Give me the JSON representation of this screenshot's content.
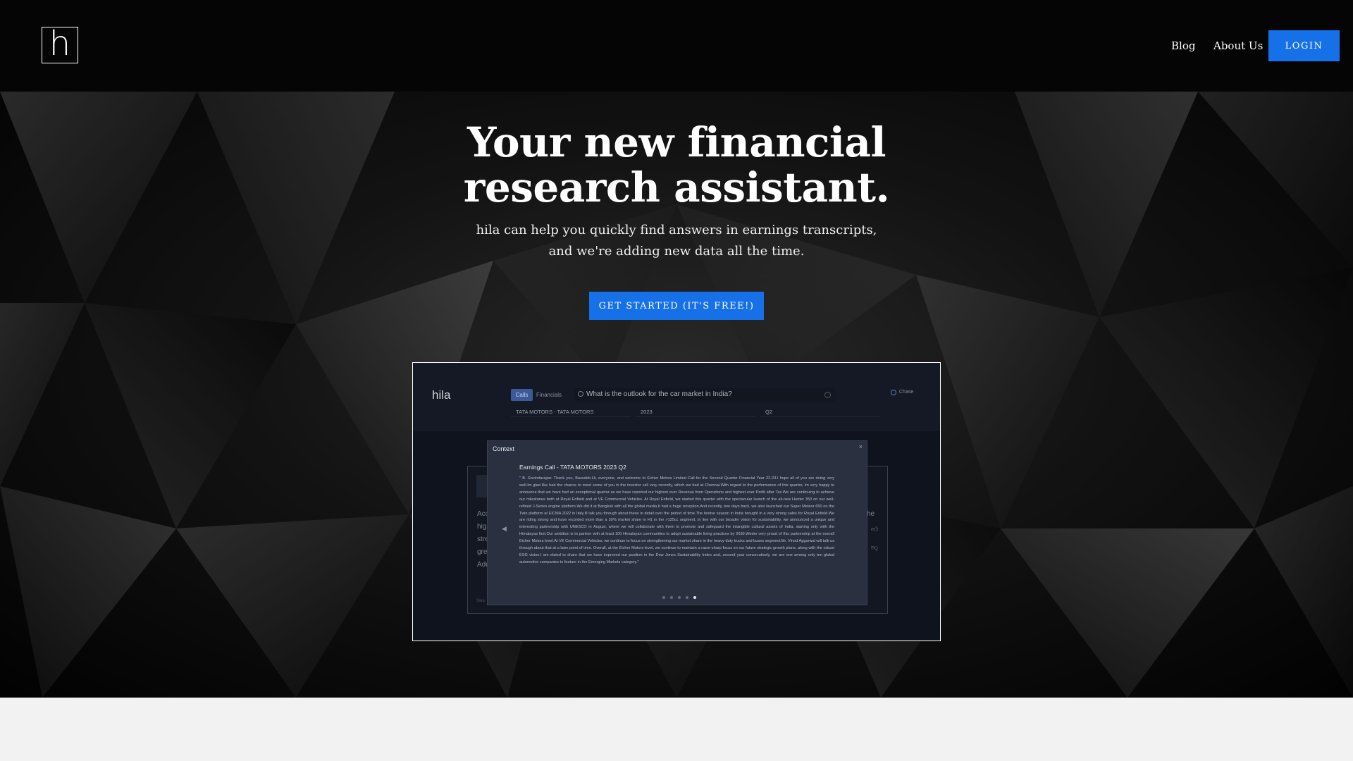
{
  "header": {
    "logo_letter": "h",
    "nav": {
      "blog": "Blog",
      "about": "About Us"
    },
    "login_label": "LOGIN"
  },
  "hero": {
    "headline_line1": "Your new financial",
    "headline_line2": "research assistant.",
    "subtitle_line1": "hila can help you quickly find answers in earnings transcripts,",
    "subtitle_line2": "and we're adding new data all the time.",
    "cta_label": "GET STARTED (IT'S FREE!)"
  },
  "preview": {
    "app_name": "hila",
    "tabs": [
      "Calls",
      "Financials"
    ],
    "search_query": "What is the outlook for the car market in India?",
    "user_label": "Chase",
    "filters": [
      "TATA MOTORS - TATA MOTORS",
      "2023",
      "Q2"
    ],
    "side_left": [
      "Acc",
      "hig",
      "stre",
      "gre",
      "Add"
    ],
    "side_right": "he",
    "modal": {
      "title": "Context",
      "close_label": "×",
      "heading": "Earnings Call - TATA MOTORS 2023 Q2",
      "body": "\" B. Govindarajan: Thank you, Basudeb.Hi, everyone, and welcome to Eicher Motors Limited Call for the Second Quarter Financial Year 22-23.I hope all of you are doing very well.Im glad like had the chance to meet some of you in the investor call very recently, which we had at Chennai.With regard to the performance of this quarter, Im very happy to announce that we have had an exceptional quarter as we have reported our highest ever Revenue from Operations and highest ever Profit after Tax.We are continuing to achieve our milestones both at Royal Enfield and at VE Commercial Vehicles. At Royal Enfield, we started this quarter with the spectacular launch of the all-new Hunter 350 on our well-refined J-Series engine platform.We did it at Bangkok with all the global media.It had a huge reception.And recently, two days back, we also launched our Super Meteor 650 on the Twin platform at EICMA 2022 in Italy.Ill talk you through about these in detail over the period of time.The festive season in India brought in a very strong sales for Royal Enfield.We are riding strong and have recorded more than a 30% market share in H1 in the >125cc segment. In line with our broader vision for sustainability, we announced a unique and interesting partnership with UNESCO in August, where we will collaborate with them to promote and safeguard the intangible cultural assets of India, starting only with the Himalayas first.Our ambition is to partner with at least 100 Himalayan communities to adopt sustainable living practices by 2030.Wedre very proud of this partnership at the overall Eicher Motors level.At VE Commercial Vehicles, we continue to focus on strengthening our market share in the heavy-duty trucks and buses segment.Mr. Vinod Aggarwal will talk us through about that at a later point of time. Overall, at the Eicher Motors level, we continue to maintain a razor-sharp focus on our future strategic growth plans, along with the robust ESG vision.I am elated to share that we have improved our position in the Dow Jones Sustainability Index and, second year consecutively, we are one among only ten global automotive companies to feature in the Emerging Markets category.\"",
      "page_count": 5,
      "active_page": 5
    },
    "footer_small": "Swa"
  },
  "colors": {
    "accent": "#1671e8",
    "background": "#000000",
    "bottom_strip": "#f2f2f3"
  },
  "icons": [
    "logo-h-icon",
    "search-icon",
    "clear-icon",
    "user-icon",
    "chevron-left-icon",
    "thumbs-up-icon",
    "thumbs-down-icon",
    "close-icon"
  ]
}
